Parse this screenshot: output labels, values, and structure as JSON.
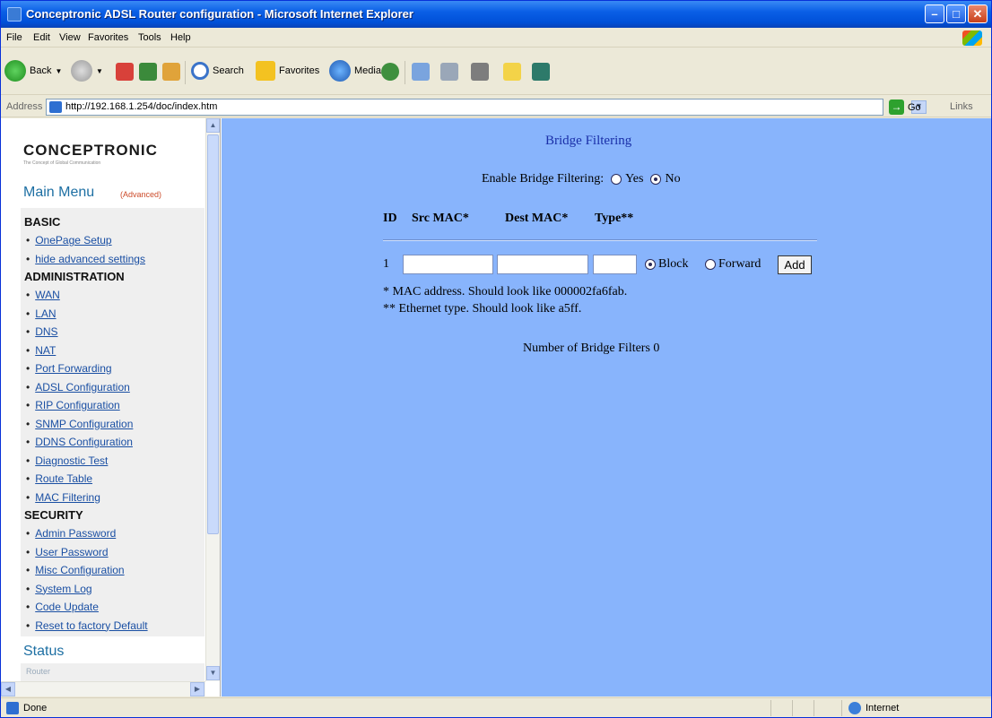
{
  "window": {
    "title": "Conceptronic ADSL Router configuration - Microsoft Internet Explorer"
  },
  "menubar": [
    "File",
    "Edit",
    "View",
    "Favorites",
    "Tools",
    "Help"
  ],
  "toolbar": {
    "back": "Back",
    "search": "Search",
    "favorites": "Favorites",
    "media": "Media"
  },
  "address": {
    "label": "Address",
    "url": "http://192.168.1.254/doc/index.htm",
    "go": "Go",
    "links": "Links"
  },
  "sidebar": {
    "brand": "CONCEPTRONIC",
    "tagline": "The Concept of Global Communication",
    "menu_title": "Main Menu",
    "mode": "(Advanced)",
    "sections": [
      {
        "title": "BASIC",
        "items": [
          "OnePage Setup",
          "hide advanced settings"
        ]
      },
      {
        "title": "ADMINISTRATION",
        "items": [
          "WAN",
          "LAN",
          "DNS",
          "NAT",
          "Port Forwarding",
          "ADSL Configuration",
          "RIP Configuration",
          "SNMP Configuration",
          "DDNS Configuration",
          "Diagnostic Test",
          "Route Table",
          "MAC Filtering"
        ]
      },
      {
        "title": "SECURITY",
        "items": [
          "Admin Password",
          "User Password",
          "Misc Configuration",
          "System Log",
          "Code Update",
          "Reset to factory Default"
        ]
      }
    ],
    "status_title": "Status",
    "status_item": "Router"
  },
  "main": {
    "title": "Bridge Filtering",
    "enable_label": "Enable Bridge Filtering:",
    "yes": "Yes",
    "no": "No",
    "enable_selected": "No",
    "headers": {
      "id": "ID",
      "src": "Src MAC*",
      "dest": "Dest MAC*",
      "type": "Type**"
    },
    "row": {
      "id": "1",
      "block": "Block",
      "forward": "Forward",
      "selected": "Block",
      "add": "Add"
    },
    "note1": "* MAC address. Should look like 000002fa6fab.",
    "note2": "** Ethernet type. Should look like a5ff.",
    "count_label": "Number of Bridge Filters 0"
  },
  "statusbar": {
    "text": "Done",
    "zone": "Internet"
  }
}
